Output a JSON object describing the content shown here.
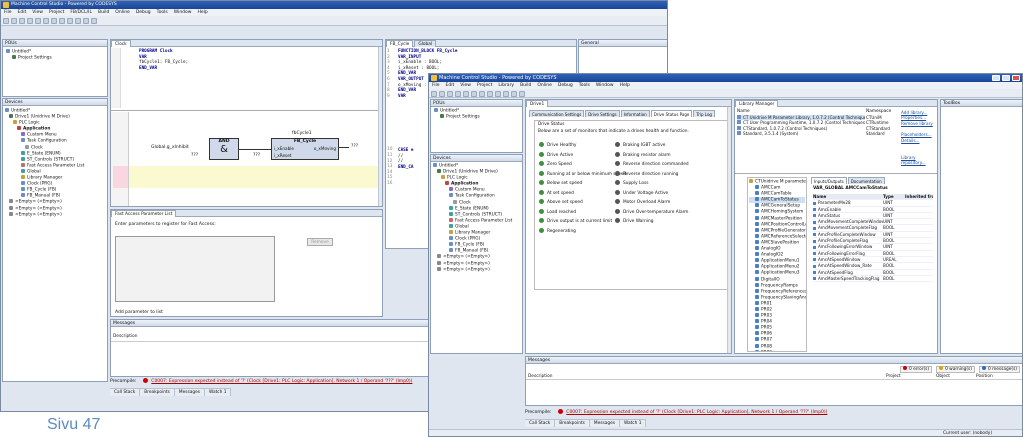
{
  "back_window": {
    "title": "Machine Control Studio - Powered by CODESYS",
    "menu": [
      "File",
      "Edit",
      "View",
      "Project",
      "FB/DCL/IL",
      "Build",
      "Online",
      "Debug",
      "Tools",
      "Window",
      "Help"
    ],
    "pous": {
      "title": "POUs",
      "items": [
        "Untitled*",
        "Project Settings"
      ]
    },
    "devices": {
      "title": "Devices",
      "items": [
        "Untitled*",
        "Drive1 (Unidrive M Drive)",
        "PLC Logic",
        "Application",
        "Custom Menu",
        "Task Configuration",
        "Clock",
        "E_State (ENUM)",
        "ST_Controls (STRUCT)",
        "Fast Access Parameter List",
        "Global",
        "Library Manager",
        "Clock (PRG)",
        "FB_Cycle (FB)",
        "FB_Manual (FB)",
        "<Empty> (<Empty>)",
        "<Empty> (<Empty>)",
        "<Empty> (<Empty>)"
      ]
    },
    "clock_tab": "Clock",
    "clock_code": [
      "PROGRAM Clock",
      "VAR",
      "    fbCycle1: FB_Cycle;",
      "END_VAR"
    ],
    "ladder": {
      "global_var": "Global.g_xInhibit",
      "and_block": "AND",
      "and_symbol": "&",
      "fb_instance": "fbCycle1",
      "fb_type": "FB_Cycle",
      "pin_enable": "i_xEnable",
      "pin_reset": "i_xReset",
      "pin_out": "o_xMoving",
      "placeholder": "???"
    },
    "fb_tabs": [
      "FB_Cycle",
      "Global"
    ],
    "fb_code": [
      "FUNCTION_BLOCK FB_Cycle",
      "VAR_INPUT",
      "    i_xEnable   :  BOOL;",
      "    i_xReset    :  BOOL;",
      "END_VAR",
      "VAR_OUTPUT",
      "    o_xMoving  : BOOL;",
      "END_VAR",
      "VAR"
    ],
    "fb_code_lower": [
      "CASE e",
      "   //",
      "   //",
      "END_CA"
    ],
    "fast_access": {
      "tab": "Fast Access Parameter List",
      "prompt": "Enter parameters to register for Fast Access:",
      "remove_button": "Remove",
      "add_link": "Add parameter to list"
    },
    "messages": {
      "title": "Messages",
      "column": "Description"
    },
    "precompile_label": "Precompile:",
    "error_text": "C0007: Expression expected instead of '?' (Clock [Drive1: PLC Logic: Application], Network 1 / Operand '???' (Imp0))",
    "bottom_tabs": [
      "Call Stack",
      "Breakpoints",
      "Messages",
      "Watch 1"
    ]
  },
  "front_window": {
    "title": "Machine Control Studio - Powered by CODESYS",
    "menu": [
      "File",
      "Edit",
      "View",
      "Project",
      "Library",
      "Build",
      "Online",
      "Debug",
      "Tools",
      "Window",
      "Help"
    ],
    "pous_items": [
      "Untitled*",
      "Project Settings"
    ],
    "device_items": [
      "Untitled*",
      "Drive1 (Unidrive M Drive)",
      "PLC Logic",
      "Application",
      "Custom Menu",
      "Task Configuration",
      "Clock",
      "E_State (ENUM)",
      "ST_Controls (STRUCT)",
      "Fast Access Parameter List",
      "Global",
      "Library Manager",
      "Clock (PRG)",
      "FB_Cycle (FB)",
      "FB_Manual (FB)",
      "<Empty> (<Empty>)",
      "<Empty> (<Empty>)",
      "<Empty> (<Empty>)"
    ],
    "drive_tab": "Drive1",
    "drive_subtabs": [
      "Communication Settings",
      "Drive Settings",
      "Information",
      "Drive Status Page",
      "Trip Log"
    ],
    "drive_status_title": "Drive Status",
    "drive_status_desc": "Below are a set of monitors that indicate a drives health and function.",
    "status_left": [
      "Drive Healthy",
      "Drive Active",
      "Zero Speed",
      "Running at or below minimum speed",
      "Below set speed",
      "At set speed",
      "Above set speed",
      "Load reached",
      "Drive output is at current limit",
      "Regenerating"
    ],
    "status_right": [
      "Braking IGBT active",
      "Braking resistor alarm",
      "Reverse direction commanded",
      "Reverse direction running",
      "Supply Loss",
      "Under Voltage Active",
      "Motor Overload Alarm",
      "Drive Over-temperature Alarm",
      "Drive Warning"
    ],
    "libman": {
      "tab": "Library Manager",
      "name_header": "Name",
      "namespace_header": "Namespace",
      "libs": [
        "CT Unidrive M Parameter Library, 1.0.7.2 (Control Techniques)",
        "CT User Programming Runtime, 1.0.7.2 (Control Techniques)",
        "CTStandard, 1.0.7.2 (Control Techniques)",
        "Standard, 3.5.1.4 (System)"
      ],
      "namespaces": [
        "CTUniM",
        "CTRuntime",
        "CTStandard",
        "Standard"
      ],
      "links": [
        "Add library...",
        "Properties...",
        "Remove library",
        "Placeholders...",
        "Details...",
        "Library repository..."
      ],
      "tree_root": "CTUnidrive M parameter",
      "tree_items": [
        "AMCCam",
        "AMCCamTable",
        "AMCCamToStatus",
        "AMCGeneralSetup",
        "AMCHomingSystem",
        "AMCMasterPosition",
        "AMCPositionControlLoop",
        "AMCProfileGenerator",
        "AMCReferenceSelector",
        "AMCSlavePosition",
        "AnalogIO",
        "AnalogIO2",
        "ApplicationMenu1",
        "ApplicationMenu2",
        "ApplicationMenu3",
        "DigitalIO",
        "FrequencyRamps",
        "FrequencyReferences",
        "FrequencySlavingAndPo",
        "PR01",
        "PR02",
        "PR03",
        "PR04",
        "PR05",
        "PR06",
        "PR07",
        "PR08",
        "PR09",
        "PR10"
      ],
      "subtabs": [
        "Inputs/Outputs",
        "Documentation"
      ],
      "var_header": "VAR_GLOBAL AMCCamToStatus",
      "table_headers": [
        "Name",
        "Type",
        "Inherited from"
      ],
      "table_rows": [
        [
          "ParameterMe28",
          "UINT"
        ],
        [
          "AmcEnable",
          "BOOL"
        ],
        [
          "AmcStatus",
          "UINT"
        ],
        [
          "AmcMovementCompleteWindow",
          "UINT"
        ],
        [
          "AmcMovementCompleteFlag",
          "BOOL"
        ],
        [
          "AmcProfileCompleteWindow",
          "UINT"
        ],
        [
          "AmcProfileCompleteFlag",
          "BOOL"
        ],
        [
          "AmcFollowingErrorWindow",
          "UINT"
        ],
        [
          "AmcFollowingErrorFlag",
          "BOOL"
        ],
        [
          "AmcAtSpeedWindow",
          "UREAL"
        ],
        [
          "AmcAtSpeedWindow_Rate",
          "BOOL"
        ],
        [
          "AmcAtSpeedFlag",
          "BOOL"
        ],
        [
          "AmcMasterSpeedTrackingFlag",
          "BOOL"
        ]
      ]
    },
    "toolbox_title": "ToolBox",
    "messages_title": "Messages",
    "messages_columns": [
      "Description",
      "Project",
      "Object",
      "Position"
    ],
    "msg_counts": [
      "0 error(s)",
      "0 warning(s)",
      "0 message(s)"
    ],
    "precompile_label": "Precompile:",
    "error_text": "C0007: Expression expected instead of '?' (Clock [Drive1: PLC Logic: Application], Network 1 / Operand '???' (Imp0))",
    "bottom_tabs": [
      "Call Stack",
      "Breakpoints",
      "Messages",
      "Watch 1"
    ],
    "status_bar": "Current user: (nobody)"
  },
  "page_label": "Sivu 47",
  "colors": {
    "titlebar": "#1b4596",
    "lamp_on": "#3f8f3f",
    "lamp_off": "#555555",
    "page_label": "#5b8bc0",
    "error": "#aa0000"
  }
}
